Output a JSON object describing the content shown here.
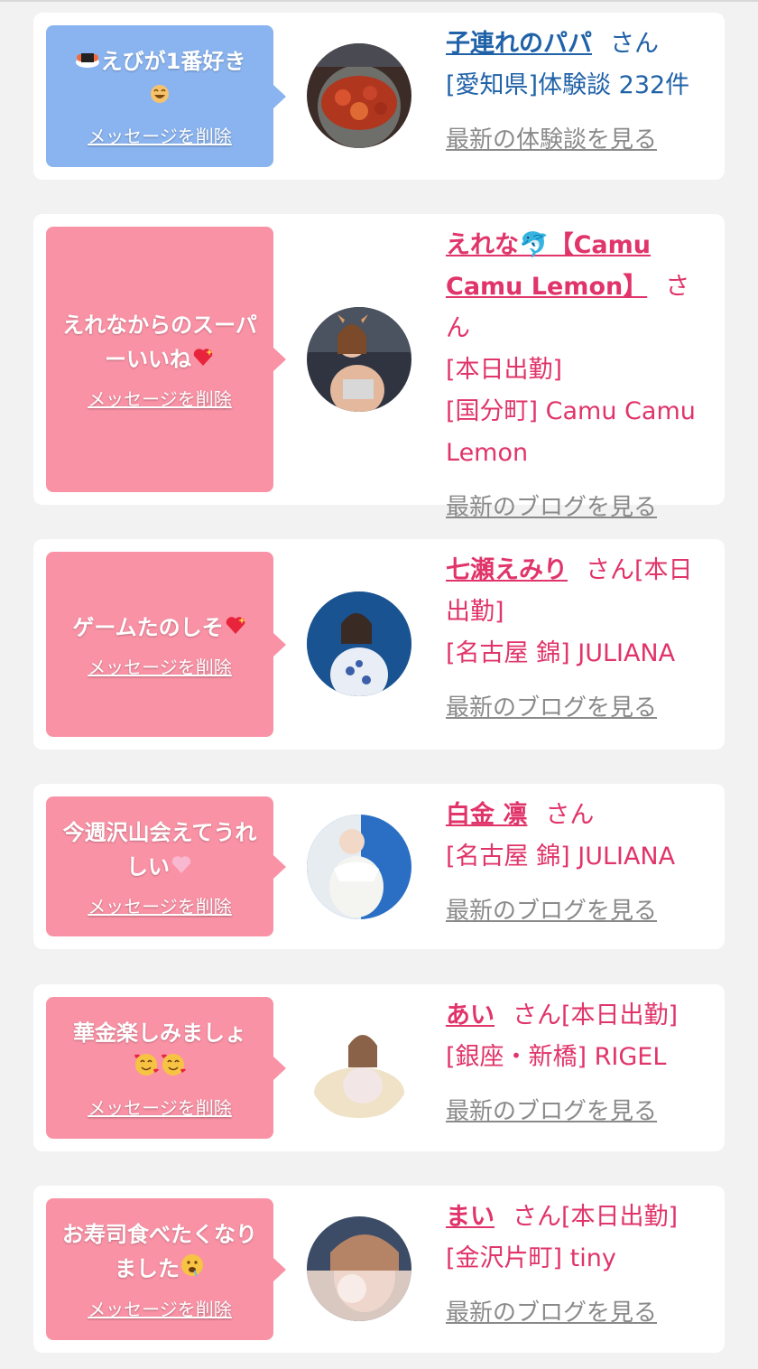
{
  "delete_label": "メッセージを削除",
  "colors": {
    "blue_bubble": "#8ab4f0",
    "pink_bubble": "#fa92a6",
    "blue_text": "#2062a8",
    "pink_text": "#e0346a",
    "link_gray": "#8a8a8a",
    "background": "#f2f2f2"
  },
  "cards": [
    {
      "theme": "blue",
      "message": "えびが1番好き",
      "message_icons": [
        "sushi-emoji",
        "laughing-emoji"
      ],
      "avatar": "food-photo-avatar",
      "name": "子連れのパパ",
      "suffix": "さん",
      "detail_lines": [
        "[愛知県]体験談 232件"
      ],
      "link": "最新の体験談を見る"
    },
    {
      "theme": "pink",
      "message": "えれなからのスーパーいいね",
      "message_icons": [
        "sparkling-heart-emoji"
      ],
      "avatar": "profile-photo-avatar",
      "name": "えれな🐬【Camu Camu Lemon】",
      "suffix": "さん",
      "detail_lines": [
        "[本日出勤]",
        "[国分町] Camu Camu Lemon"
      ],
      "link": "最新のブログを見る"
    },
    {
      "theme": "pink",
      "message": "ゲームたのしそ",
      "message_icons": [
        "sparkling-heart-emoji"
      ],
      "avatar": "profile-photo-avatar",
      "name": "七瀬えみり",
      "suffix": "さん[本日出勤]",
      "detail_lines": [
        "[名古屋 錦] JULIANA"
      ],
      "link": "最新のブログを見る"
    },
    {
      "theme": "pink",
      "message": "今週沢山会えてうれしい",
      "message_icons": [
        "pink-heart-emoji"
      ],
      "avatar": "profile-photo-avatar",
      "name": "白金 凛",
      "suffix": "さん",
      "detail_lines": [
        "[名古屋 錦] JULIANA"
      ],
      "link": "最新のブログを見る"
    },
    {
      "theme": "pink",
      "message": "華金楽しみましょ",
      "message_icons": [
        "smiling-hearts-emoji",
        "smiling-hearts-emoji"
      ],
      "avatar": "profile-photo-avatar",
      "name": "あい",
      "suffix": "さん[本日出勤]",
      "detail_lines": [
        "[銀座・新橋] RIGEL"
      ],
      "link": "最新のブログを見る"
    },
    {
      "theme": "pink",
      "message": "お寿司食べたくなりました",
      "message_icons": [
        "drooling-face-emoji"
      ],
      "avatar": "profile-photo-avatar",
      "name": "まい",
      "suffix": "さん[本日出勤]",
      "detail_lines": [
        "[金沢片町] tiny"
      ],
      "link": "最新のブログを見る"
    }
  ]
}
